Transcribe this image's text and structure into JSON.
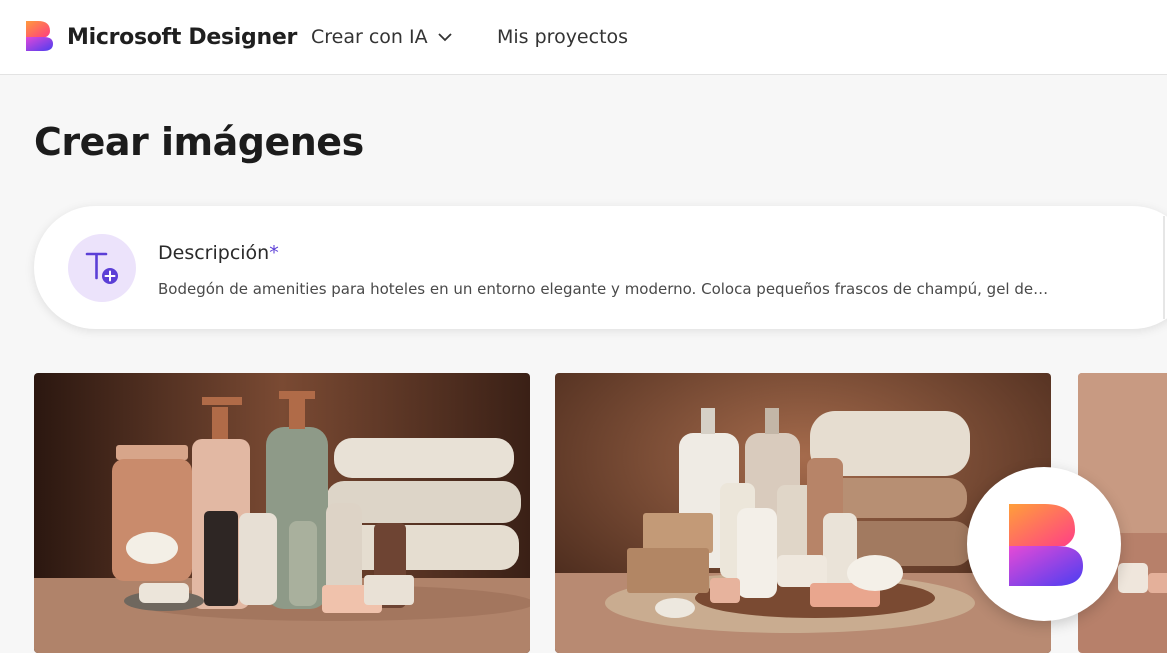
{
  "header": {
    "brand": "Microsoft Designer",
    "nav": [
      {
        "label": "Crear con IA"
      },
      {
        "label": "Mis proyectos"
      }
    ]
  },
  "page": {
    "title": "Crear imágenes"
  },
  "prompt": {
    "label": "Descripción",
    "required_mark": "*",
    "text": "Bodegón de amenities para hoteles en un entorno elegante y moderno. Coloca pequeños frascos de champú, gel de…"
  },
  "colors": {
    "accent": "#5b3fd6",
    "icon_bg": "#ece3fb",
    "page_bg": "#f7f7f7"
  },
  "icons": {
    "logo": "microsoft-designer-logo",
    "prompt": "text-add-icon",
    "nav_chevron": "chevron-down-icon"
  }
}
